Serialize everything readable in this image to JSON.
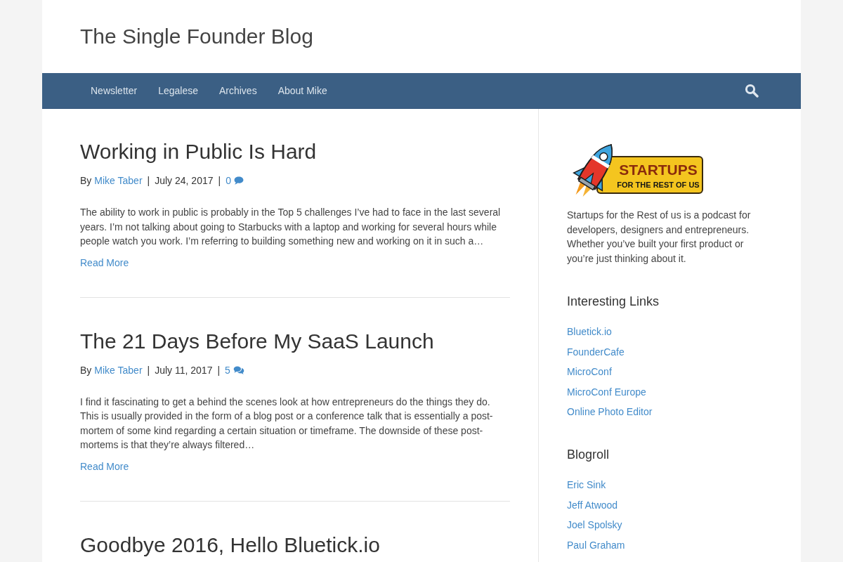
{
  "site": {
    "title": "The Single Founder Blog"
  },
  "nav": {
    "items": [
      "Newsletter",
      "Legalese",
      "Archives",
      "About Mike"
    ]
  },
  "posts": [
    {
      "title": "Working in Public Is Hard",
      "meta": {
        "by": "By",
        "author": "Mike Taber",
        "separator_1": "|",
        "date": "July 24, 2017",
        "separator_2": "|",
        "comments": {
          "count": "0",
          "kind": "single"
        }
      },
      "excerpt": "The ability to work in public is probably in the Top 5 challenges I’ve had to face in the last several years. I’m not talking about going to Starbucks with a laptop and working for several hours while people watch you work. I’m referring to building something new and working on it in such a…",
      "read_more": "Read More"
    },
    {
      "title": "The 21 Days Before My SaaS Launch",
      "meta": {
        "by": "By",
        "author": "Mike Taber",
        "separator_1": "|",
        "date": "July 11, 2017",
        "separator_2": "|",
        "comments": {
          "count": "5",
          "kind": "multiple"
        }
      },
      "excerpt": "I find it fascinating to get a behind the scenes look at how entrepreneurs do the things they do. This is usually provided in the form of a blog post or a conference talk that is essentially a post-mortem of some kind regarding a certain situation or timeframe. The downside of these post-mortems is that they’re always filtered…",
      "read_more": "Read More"
    },
    {
      "title": "Goodbye 2016, Hello Bluetick.io"
    }
  ],
  "sidebar": {
    "logo": {
      "title": "STARTUPS",
      "subtitle": "FOR THE REST OF US"
    },
    "about": "Startups for the Rest of us is a podcast for developers, designers and entrepreneurs. Whether you’ve built your first product or you’re just thinking about it.",
    "widgets": [
      {
        "title": "Interesting Links",
        "links": [
          "Bluetick.io",
          "FounderCafe",
          "MicroConf",
          "MicroConf Europe",
          "Online Photo Editor"
        ]
      },
      {
        "title": "Blogroll",
        "links": [
          "Eric Sink",
          "Jeff Atwood",
          "Joel Spolsky",
          "Paul Graham"
        ]
      }
    ]
  }
}
